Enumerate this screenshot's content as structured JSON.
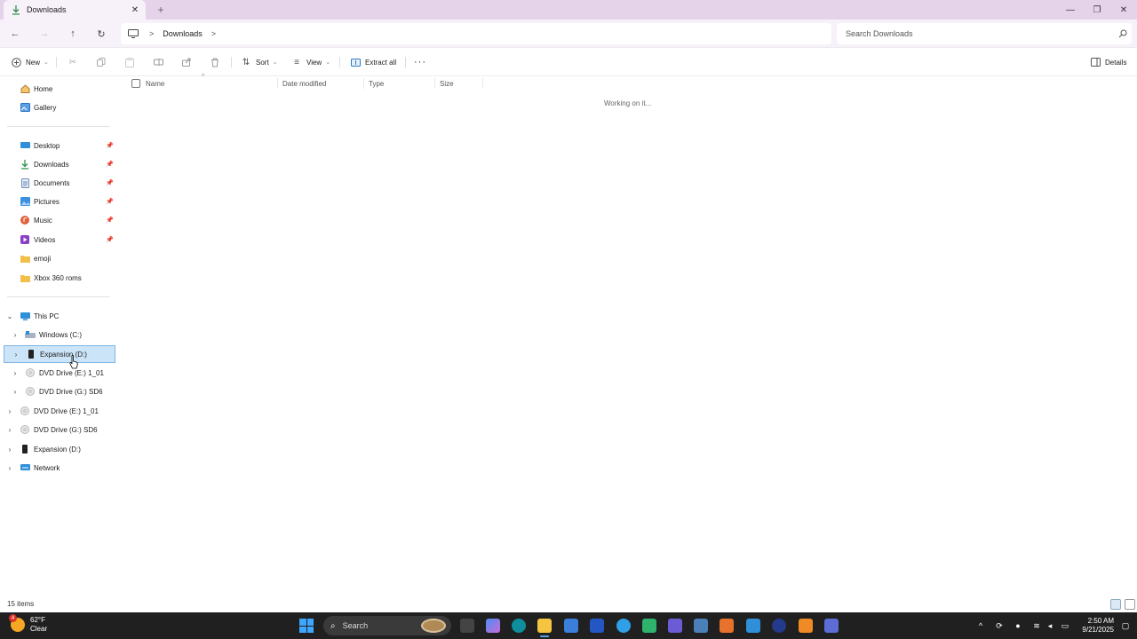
{
  "window": {
    "tab_title": "Downloads",
    "tab_icon": "download-icon",
    "new_tab_glyph": "+",
    "close_glyph": "✕",
    "minimize_glyph": "—",
    "maximize_glyph": "❐",
    "window_close_glyph": "✕"
  },
  "nav": {
    "back_glyph": "←",
    "forward_glyph": "→",
    "up_glyph": "↑",
    "refresh_glyph": "↻",
    "breadcrumb": [
      "Downloads"
    ],
    "crumb_sep": ">",
    "search_placeholder": "Search Downloads"
  },
  "toolbar": {
    "new_label": "New",
    "sort_label": "Sort",
    "view_label": "View",
    "extract_label": "Extract all",
    "more_label": "···",
    "details_label": "Details"
  },
  "sidebar": {
    "quick": [
      {
        "label": "Home",
        "icon": "home-icon",
        "pinned": false
      },
      {
        "label": "Gallery",
        "icon": "gallery-icon",
        "pinned": false
      }
    ],
    "pinned": [
      {
        "label": "Desktop",
        "icon": "desktop-icon"
      },
      {
        "label": "Downloads",
        "icon": "download-icon"
      },
      {
        "label": "Documents",
        "icon": "document-icon"
      },
      {
        "label": "Pictures",
        "icon": "pictures-icon"
      },
      {
        "label": "Music",
        "icon": "music-icon"
      },
      {
        "label": "Videos",
        "icon": "videos-icon"
      },
      {
        "label": "emoji",
        "icon": "folder-icon"
      },
      {
        "label": "Xbox 360 roms",
        "icon": "folder-icon"
      }
    ],
    "tree": [
      {
        "label": "This PC",
        "expanded": true
      },
      {
        "label": "Windows (C:)"
      },
      {
        "label": "Expansion (D:)",
        "selected": true
      },
      {
        "label": "DVD Drive (E:) 1_01"
      },
      {
        "label": "DVD Drive (G:) SD6"
      },
      {
        "label": "DVD Drive (E:) 1_01"
      },
      {
        "label": "DVD Drive (G:) SD6"
      },
      {
        "label": "Expansion (D:)"
      },
      {
        "label": "Network"
      }
    ]
  },
  "columns": {
    "name": "Name",
    "date": "Date modified",
    "type": "Type",
    "size": "Size"
  },
  "content": {
    "status_message": "Working on it..."
  },
  "statusbar": {
    "item_count": "15 items"
  },
  "taskbar": {
    "weather_temp": "62°F",
    "weather_cond": "Clear",
    "weather_badge": "4",
    "search_label": "Search",
    "time": "2:50 AM",
    "date": "9/21/2025"
  },
  "colors": {
    "accent": "#0067c0",
    "selection": "#cce4f7",
    "titlebar": "#e5d3ea",
    "taskbar": "#202020"
  }
}
